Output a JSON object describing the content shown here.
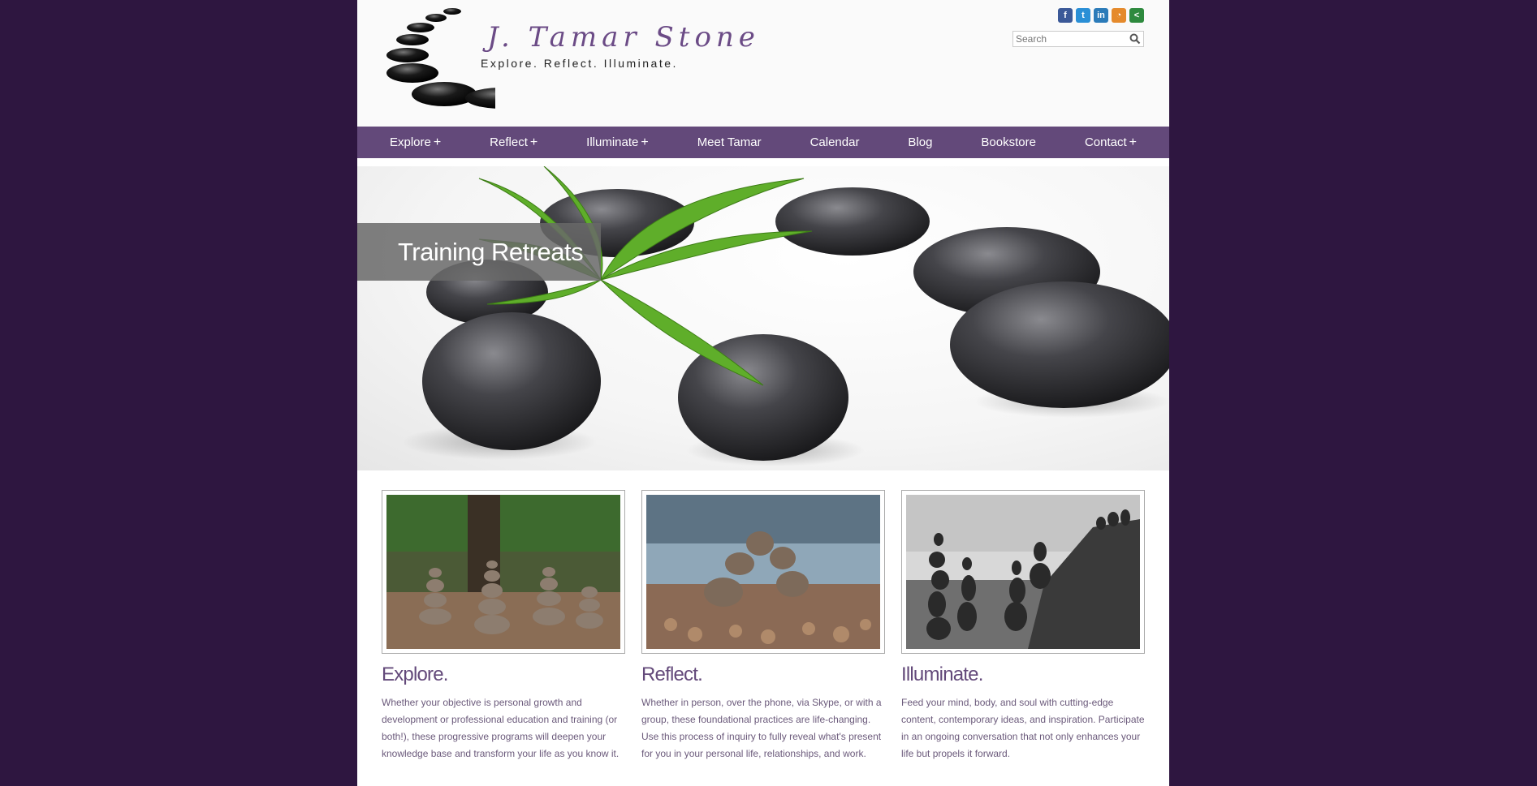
{
  "header": {
    "logo": {
      "name": "J. Tamar Stone",
      "tagline": "Explore. Reflect. Illuminate."
    },
    "social_icons": [
      {
        "icon": "facebook-icon",
        "glyph": "f",
        "color": "#3b5998"
      },
      {
        "icon": "twitter-icon",
        "glyph": "t",
        "color": "#2a8fd6"
      },
      {
        "icon": "linkedin-icon",
        "glyph": "in",
        "color": "#2b7bb9"
      },
      {
        "icon": "rss-icon",
        "glyph": "◔",
        "color": "#e58a2c"
      },
      {
        "icon": "share-icon",
        "glyph": "<",
        "color": "#2e8a3e"
      }
    ],
    "search": {
      "placeholder": "Search",
      "icon": "search-icon"
    }
  },
  "nav": {
    "items": [
      {
        "label": "Explore",
        "has_submenu": true
      },
      {
        "label": "Reflect",
        "has_submenu": true
      },
      {
        "label": "Illuminate",
        "has_submenu": true
      },
      {
        "label": "Meet Tamar",
        "has_submenu": false
      },
      {
        "label": "Calendar",
        "has_submenu": false
      },
      {
        "label": "Blog",
        "has_submenu": false
      },
      {
        "label": "Bookstore",
        "has_submenu": false
      },
      {
        "label": "Contact",
        "has_submenu": true
      }
    ],
    "submenu_glyph": "+"
  },
  "hero": {
    "caption": "Training Retreats"
  },
  "columns": [
    {
      "heading": "Explore.",
      "text": "Whether your objective is personal growth and development or professional education and training (or both!), these progressive programs will deepen your knowledge base and transform your life as you know it."
    },
    {
      "heading": "Reflect.",
      "text": "Whether in person, over the phone, via Skype, or with a group, these foundational practices are life-changing. Use this process of inquiry to fully reveal what's present for you in your personal life, relationships, and work."
    },
    {
      "heading": "Illuminate.",
      "text": "Feed your mind, body, and soul with cutting-edge content, contemporary ideas, and inspiration. Participate in an ongoing conversation that not only enhances your life but propels it forward."
    }
  ],
  "colors": {
    "background": "#2e1640",
    "nav": "#63497a",
    "heading": "#63497a"
  }
}
